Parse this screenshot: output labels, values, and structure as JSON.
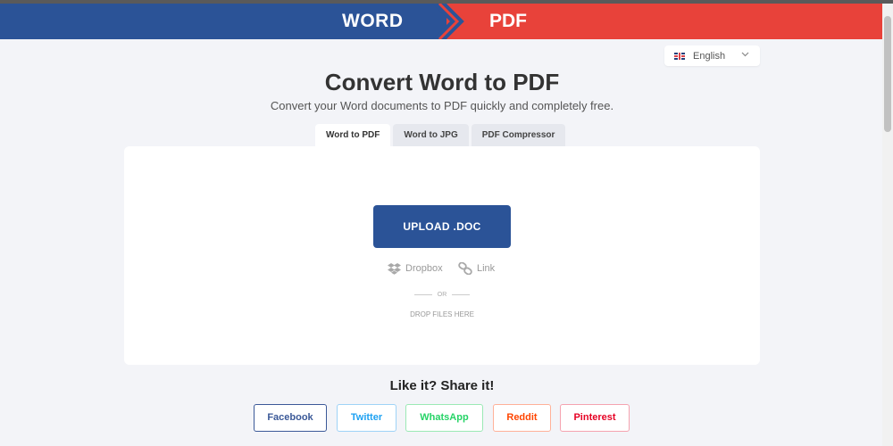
{
  "banner": {
    "left_label": "WORD",
    "right_label": "PDF"
  },
  "language": {
    "selected": "English",
    "flag_icon": "uk-flag-icon"
  },
  "header": {
    "title": "Convert Word to PDF",
    "subtitle": "Convert your Word documents to PDF quickly and completely free."
  },
  "tabs": [
    {
      "label": "Word to PDF",
      "active": true
    },
    {
      "label": "Word to JPG",
      "active": false
    },
    {
      "label": "PDF Compressor",
      "active": false
    }
  ],
  "upload": {
    "button_label": "UPLOAD .DOC",
    "dropbox_label": "Dropbox",
    "link_label": "Link",
    "or_label": "OR",
    "drop_label": "DROP FILES HERE"
  },
  "share": {
    "title": "Like it? Share it!",
    "buttons": [
      {
        "label": "Facebook",
        "color": "#3b5998"
      },
      {
        "label": "Twitter",
        "color": "#1da1f2"
      },
      {
        "label": "WhatsApp",
        "color": "#25d366"
      },
      {
        "label": "Reddit",
        "color": "#ff4500"
      },
      {
        "label": "Pinterest",
        "color": "#e60023"
      }
    ]
  },
  "colors": {
    "brand_blue": "#2b5397",
    "brand_red": "#e8423a",
    "background": "#f3f4f8"
  }
}
